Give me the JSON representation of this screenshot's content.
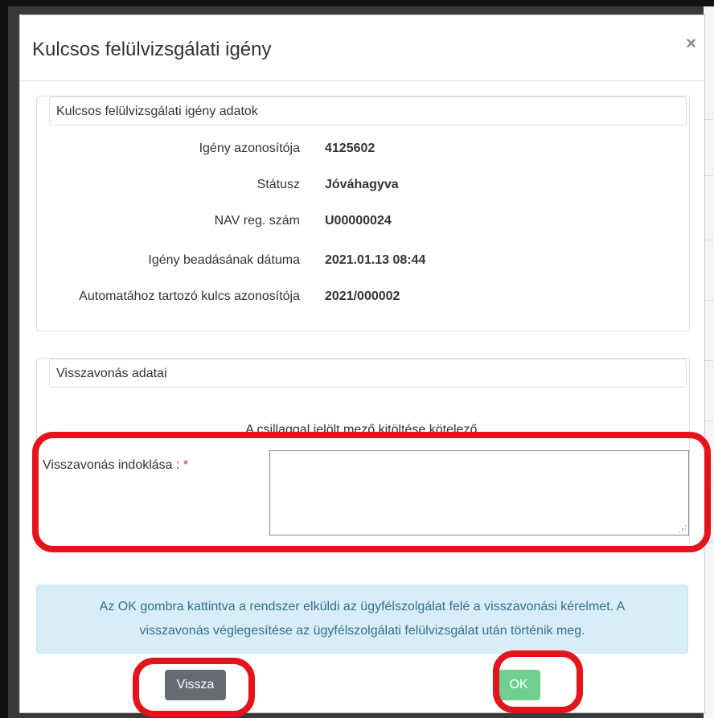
{
  "modal": {
    "title": "Kulcsos felülvizsgálati igény",
    "close_icon": "×"
  },
  "details": {
    "legend": "Kulcsos felülvizsgálati igény adatok",
    "rows": [
      {
        "label": "Igény azonosítója",
        "value": "4125602"
      },
      {
        "label": "Státusz",
        "value": "Jóváhagyva"
      },
      {
        "label": "NAV reg. szám",
        "value": "U00000024"
      },
      {
        "label": "Igény beadásának dátuma",
        "value": "2021.01.13 08:44"
      },
      {
        "label": "Automatához tartozó kulcs azonosítója",
        "value": "2021/000002"
      }
    ]
  },
  "withdrawal": {
    "legend": "Visszavonás adatai",
    "required_note": "A csillaggal jelölt mező kitöltése kötelező.",
    "reason_label": "Visszavonás indoklása : ",
    "required_mark": "*",
    "reason_value": ""
  },
  "info": {
    "line1": "Az OK gombra kattintva a rendszer elküldi az ügyfélszolgálat felé a visszavonási kérelmet. A",
    "line2": "visszavonás véglegesítése az ügyfélszolgálati felülvizsgálat után történik meg."
  },
  "buttons": {
    "back": "Vissza",
    "ok": "OK"
  },
  "colors": {
    "highlight": "#e3141c",
    "info_bg": "#d9edf7",
    "info_text": "#31708f",
    "back_button": "#666a72",
    "ok_button": "#6fcf91"
  }
}
